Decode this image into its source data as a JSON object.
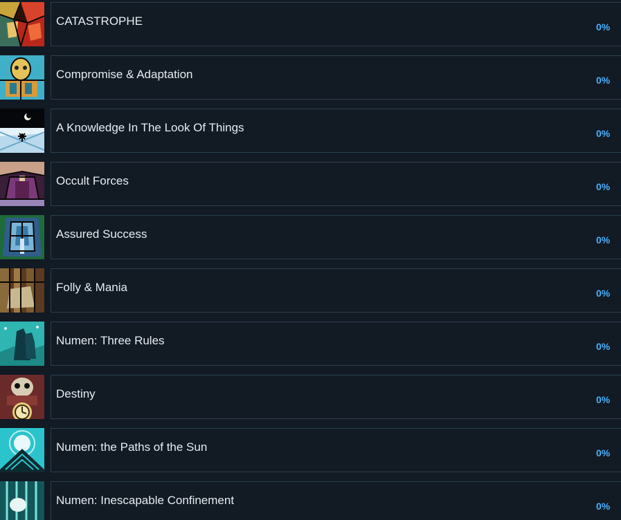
{
  "achievements": [
    {
      "title": "CATASTROPHE",
      "percent": "0%",
      "icon": "catastrophe-icon"
    },
    {
      "title": "Compromise & Adaptation",
      "percent": "0%",
      "icon": "compromise-adaptation-icon"
    },
    {
      "title": "A Knowledge In The Look Of Things",
      "percent": "0%",
      "icon": "knowledge-look-icon"
    },
    {
      "title": "Occult Forces",
      "percent": "0%",
      "icon": "occult-forces-icon"
    },
    {
      "title": "Assured Success",
      "percent": "0%",
      "icon": "assured-success-icon"
    },
    {
      "title": "Folly & Mania",
      "percent": "0%",
      "icon": "folly-mania-icon"
    },
    {
      "title": "Numen: Three Rules",
      "percent": "0%",
      "icon": "numen-three-rules-icon"
    },
    {
      "title": "Destiny",
      "percent": "0%",
      "icon": "destiny-icon"
    },
    {
      "title": "Numen: the Paths of the Sun",
      "percent": "0%",
      "icon": "numen-paths-sun-icon"
    },
    {
      "title": "Numen: Inescapable Confinement",
      "percent": "0%",
      "icon": "numen-inescapable-confinement-icon"
    }
  ]
}
